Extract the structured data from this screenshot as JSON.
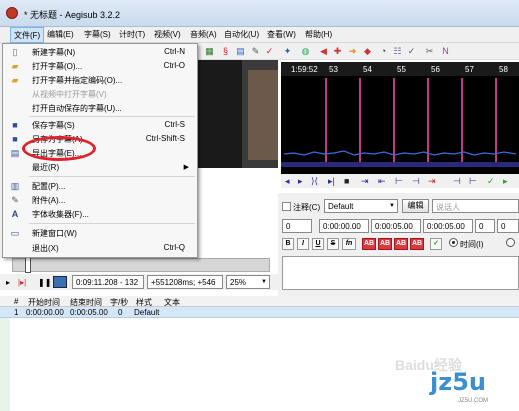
{
  "window": {
    "title": "* 无标题 - Aegisub 3.2.2"
  },
  "menubar": {
    "items": [
      "文件(F)",
      "编辑(E)",
      "字幕(S)",
      "计时(T)",
      "视频(V)",
      "音频(A)",
      "自动化(U)",
      "查看(W)",
      "帮助(H)"
    ]
  },
  "file_menu": {
    "items": [
      {
        "label": "新建字幕(N)",
        "shortcut": "Ctrl-N",
        "icon": "new-file-icon",
        "disabled": false
      },
      {
        "label": "打开字幕(O)...",
        "shortcut": "Ctrl-O",
        "icon": "open-folder-icon",
        "disabled": false
      },
      {
        "label": "打开字幕并指定编码(O)...",
        "shortcut": "",
        "icon": "open-folder-icon",
        "disabled": false
      },
      {
        "label": "从视频中打开字幕(V)",
        "shortcut": "",
        "icon": "",
        "disabled": true
      },
      {
        "label": "打开自动保存的字幕(U)...",
        "shortcut": "",
        "icon": "",
        "disabled": false
      },
      {
        "label": "保存字幕(S)",
        "shortcut": "Ctrl-S",
        "icon": "save-icon",
        "disabled": false
      },
      {
        "label": "另存为字幕(A)...",
        "shortcut": "Ctrl-Shift-S",
        "icon": "save-as-icon",
        "disabled": false
      },
      {
        "label": "导出字幕(E)...",
        "shortcut": "",
        "icon": "export-icon",
        "disabled": false
      },
      {
        "label": "最近(R)",
        "shortcut": "",
        "icon": "",
        "disabled": false,
        "submenu": true
      },
      {
        "label": "配置(P)...",
        "shortcut": "",
        "icon": "properties-icon",
        "disabled": false
      },
      {
        "label": "附件(A)...",
        "shortcut": "",
        "icon": "attachment-icon",
        "disabled": false
      },
      {
        "label": "字体收集器(F)...",
        "shortcut": "",
        "icon": "font-collector-icon",
        "disabled": false
      },
      {
        "label": "新建窗口(W)",
        "shortcut": "",
        "icon": "new-window-icon",
        "disabled": false
      },
      {
        "label": "退出(X)",
        "shortcut": "Ctrl-Q",
        "icon": "",
        "disabled": false
      }
    ]
  },
  "audio": {
    "ruler_time": "1:59:52",
    "ticks": [
      "53",
      "54",
      "55",
      "56",
      "57",
      "58"
    ]
  },
  "edit": {
    "comment_label": "注释(C)",
    "style": "Default",
    "edit_button": "编辑",
    "actor_placeholder": "说话人",
    "layer": "0",
    "start_time": "0:00:00.00",
    "end_time": "0:00:05.00",
    "duration": "0:00:05.00",
    "margin_l": "0",
    "margin_r": "0",
    "time_radio": "时间(I)",
    "format_buttons": [
      "B",
      "I",
      "U",
      "S",
      "fn",
      "AB",
      "AB",
      "AB",
      "AB"
    ]
  },
  "video_controls": {
    "time": "0:09:11.208 - 132",
    "offset": "+551208ms; +546",
    "zoom": "25%"
  },
  "grid": {
    "headers": [
      "#",
      "开始时间",
      "结束时间",
      "字/秒",
      "样式",
      "文本"
    ],
    "rows": [
      {
        "num": "1",
        "start": "0:00:00.00",
        "end": "0:00:05.00",
        "cps": "0",
        "style": "Default",
        "text": ""
      }
    ]
  },
  "watermark": {
    "baidu": "Baidu经验",
    "site": "jz5u",
    "site_sub": "JZ5U.COM"
  },
  "colors": {
    "annotation": "#e2222a",
    "audio_line": "#c5398a",
    "selected_row": "#d4e7f8"
  }
}
